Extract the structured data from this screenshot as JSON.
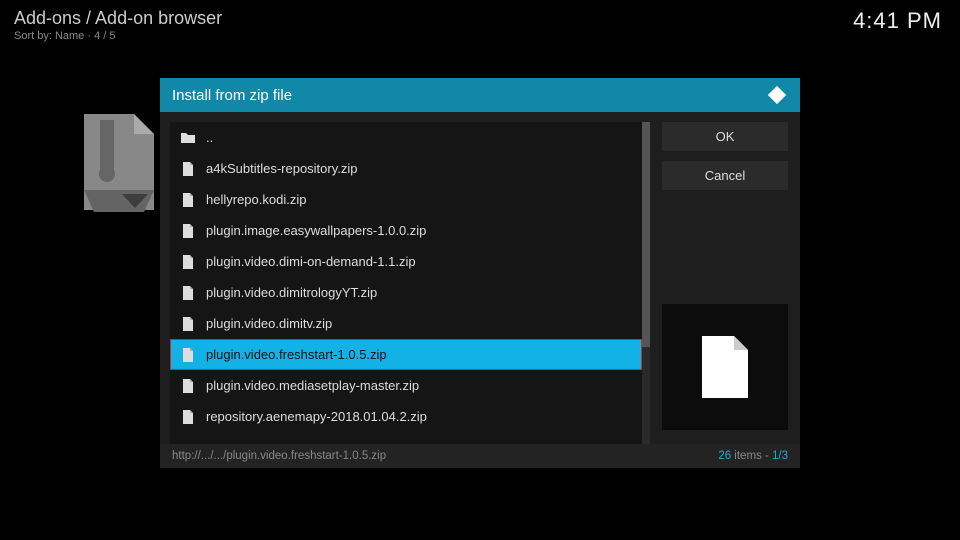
{
  "header": {
    "breadcrumb": "Add-ons / Add-on browser",
    "sort": "Sort by: Name  ·  4 / 5"
  },
  "clock": "4:41 PM",
  "dialog": {
    "title": "Install from zip file",
    "buttons": {
      "ok": "OK",
      "cancel": "Cancel"
    },
    "files": [
      {
        "label": "..",
        "icon": "folder"
      },
      {
        "label": "a4kSubtitles-repository.zip",
        "icon": "file"
      },
      {
        "label": "hellyrepo.kodi.zip",
        "icon": "file"
      },
      {
        "label": "plugin.image.easywallpapers-1.0.0.zip",
        "icon": "file"
      },
      {
        "label": "plugin.video.dimi-on-demand-1.1.zip",
        "icon": "file"
      },
      {
        "label": "plugin.video.dimitrologyYT.zip",
        "icon": "file"
      },
      {
        "label": "plugin.video.dimitv.zip",
        "icon": "file"
      },
      {
        "label": "plugin.video.freshstart-1.0.5.zip",
        "icon": "file",
        "selected": true,
        "highlighted": true
      },
      {
        "label": "plugin.video.mediasetplay-master.zip",
        "icon": "file"
      },
      {
        "label": "repository.aenemapy-2018.01.04.2.zip",
        "icon": "file"
      }
    ],
    "status_path": "http://.../.../plugin.video.freshstart-1.0.5.zip",
    "status_count": "26",
    "status_items_label": " items - ",
    "status_page": "1/3"
  }
}
